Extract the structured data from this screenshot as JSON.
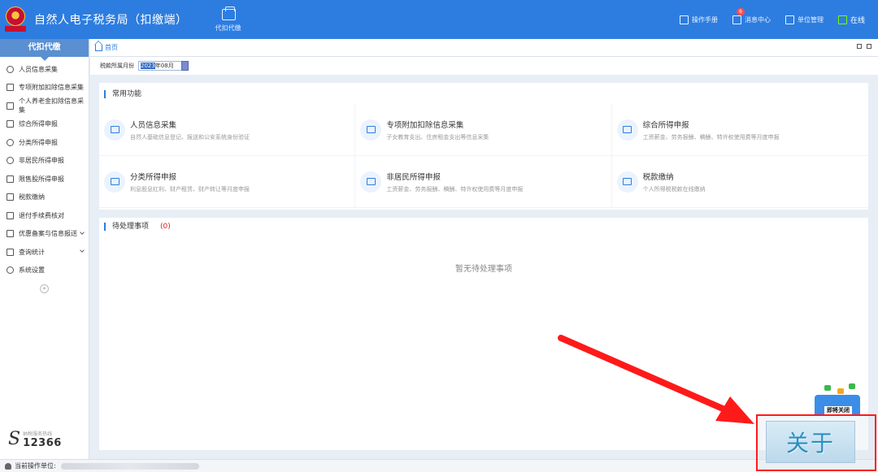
{
  "header": {
    "title": "自然人电子税务局（扣缴端）",
    "module_label": "代扣代缴",
    "actions": [
      {
        "label": "操作手册",
        "icon": "manual-icon"
      },
      {
        "label": "消息中心",
        "icon": "message-icon",
        "badge": "6"
      },
      {
        "label": "单位管理",
        "icon": "company-icon"
      },
      {
        "label": "在线",
        "icon": "online-icon"
      }
    ]
  },
  "sidebar": {
    "header": "代扣代缴",
    "items": [
      {
        "label": "人员信息采集",
        "icon": "person-icon"
      },
      {
        "label": "专项附加扣除信息采集",
        "icon": "list-icon"
      },
      {
        "label": "个人养老金扣除信息采集",
        "icon": "pension-icon"
      },
      {
        "label": "综合所得申报",
        "icon": "layers-icon"
      },
      {
        "label": "分类所得申报",
        "icon": "category-icon"
      },
      {
        "label": "非居民所得申报",
        "icon": "nonresident-icon"
      },
      {
        "label": "限售股所得申报",
        "icon": "stock-chart-icon"
      },
      {
        "label": "税款缴纳",
        "icon": "payment-icon"
      },
      {
        "label": "退付手续费核对",
        "icon": "refund-icon"
      },
      {
        "label": "优惠备案与信息报送",
        "icon": "filing-icon",
        "expandable": true
      },
      {
        "label": "查询统计",
        "icon": "query-icon",
        "expandable": true
      },
      {
        "label": "系统设置",
        "icon": "gear-icon"
      }
    ],
    "hotline_label": "纳税服务热线",
    "hotline_number": "12366"
  },
  "tabs": {
    "home": "首页"
  },
  "filter": {
    "period_label": "税款所属月份",
    "period_value_year": "2023",
    "period_value_month": "年08月"
  },
  "common_functions": {
    "title": "常用功能",
    "cards": [
      {
        "title": "人员信息采集",
        "desc": "自然人基础信息登记、报送和公安系统身份验证",
        "icon": "id-card-icon"
      },
      {
        "title": "专项附加扣除信息采集",
        "desc": "子女教育支出、住房租金支出等信息采集",
        "icon": "deduction-icon"
      },
      {
        "title": "综合所得申报",
        "desc": "工资薪金、劳务报酬、稿酬、特许权使用费等月度申报",
        "icon": "comprehensive-icon"
      },
      {
        "title": "分类所得申报",
        "desc": "利息股息红利、财产租赁、财产转让等月度申报",
        "icon": "edit-icon"
      },
      {
        "title": "非居民所得申报",
        "desc": "工资薪金、劳务报酬、稿酬、特许权使用费等月度申报",
        "icon": "edit-icon"
      },
      {
        "title": "税款缴纳",
        "desc": "个人所得税税款在线缴纳",
        "icon": "tax-payment-icon"
      }
    ]
  },
  "pending": {
    "title": "待处理事项",
    "count": "(0)",
    "empty_text": "暂无待处理事项"
  },
  "statusbar": {
    "label": "当前操作单位:"
  },
  "overlay": {
    "close_label": "关于",
    "widget_label": "即将关闭"
  },
  "colors": {
    "primary": "#2d7de0",
    "annotation": "#ff1a1a",
    "badge": "#ff4d4f"
  }
}
